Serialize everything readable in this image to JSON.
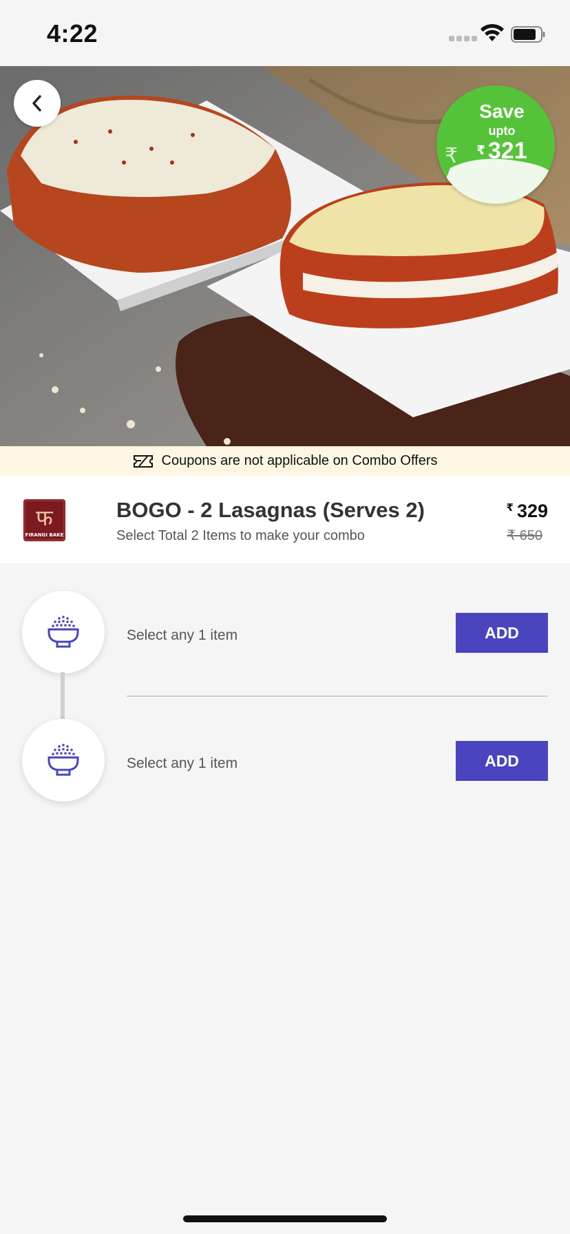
{
  "status_bar": {
    "time": "4:22"
  },
  "hero": {
    "save_badge": {
      "title": "Save",
      "upto": "upto",
      "currency": "₹",
      "amount": "321"
    }
  },
  "coupon_notice": "Coupons are not applicable on Combo Offers",
  "product": {
    "brand_logo_text": "FIRANGI BAKE",
    "title": "BOGO - 2 Lasagnas (Serves 2)",
    "subtitle": "Select Total 2 Items to make your combo",
    "currency": "₹",
    "price": "329",
    "mrp": "₹ 650"
  },
  "slots": [
    {
      "label": "Select any 1 item",
      "button": "ADD",
      "icon": "food-bowl-icon"
    },
    {
      "label": "Select any 1 item",
      "button": "ADD",
      "icon": "food-bowl-icon"
    }
  ],
  "colors": {
    "accent": "#4a44bf",
    "save_badge": "#55c23a",
    "coupon_bg": "#fdf6e3",
    "brand": "#7d1a1f"
  }
}
